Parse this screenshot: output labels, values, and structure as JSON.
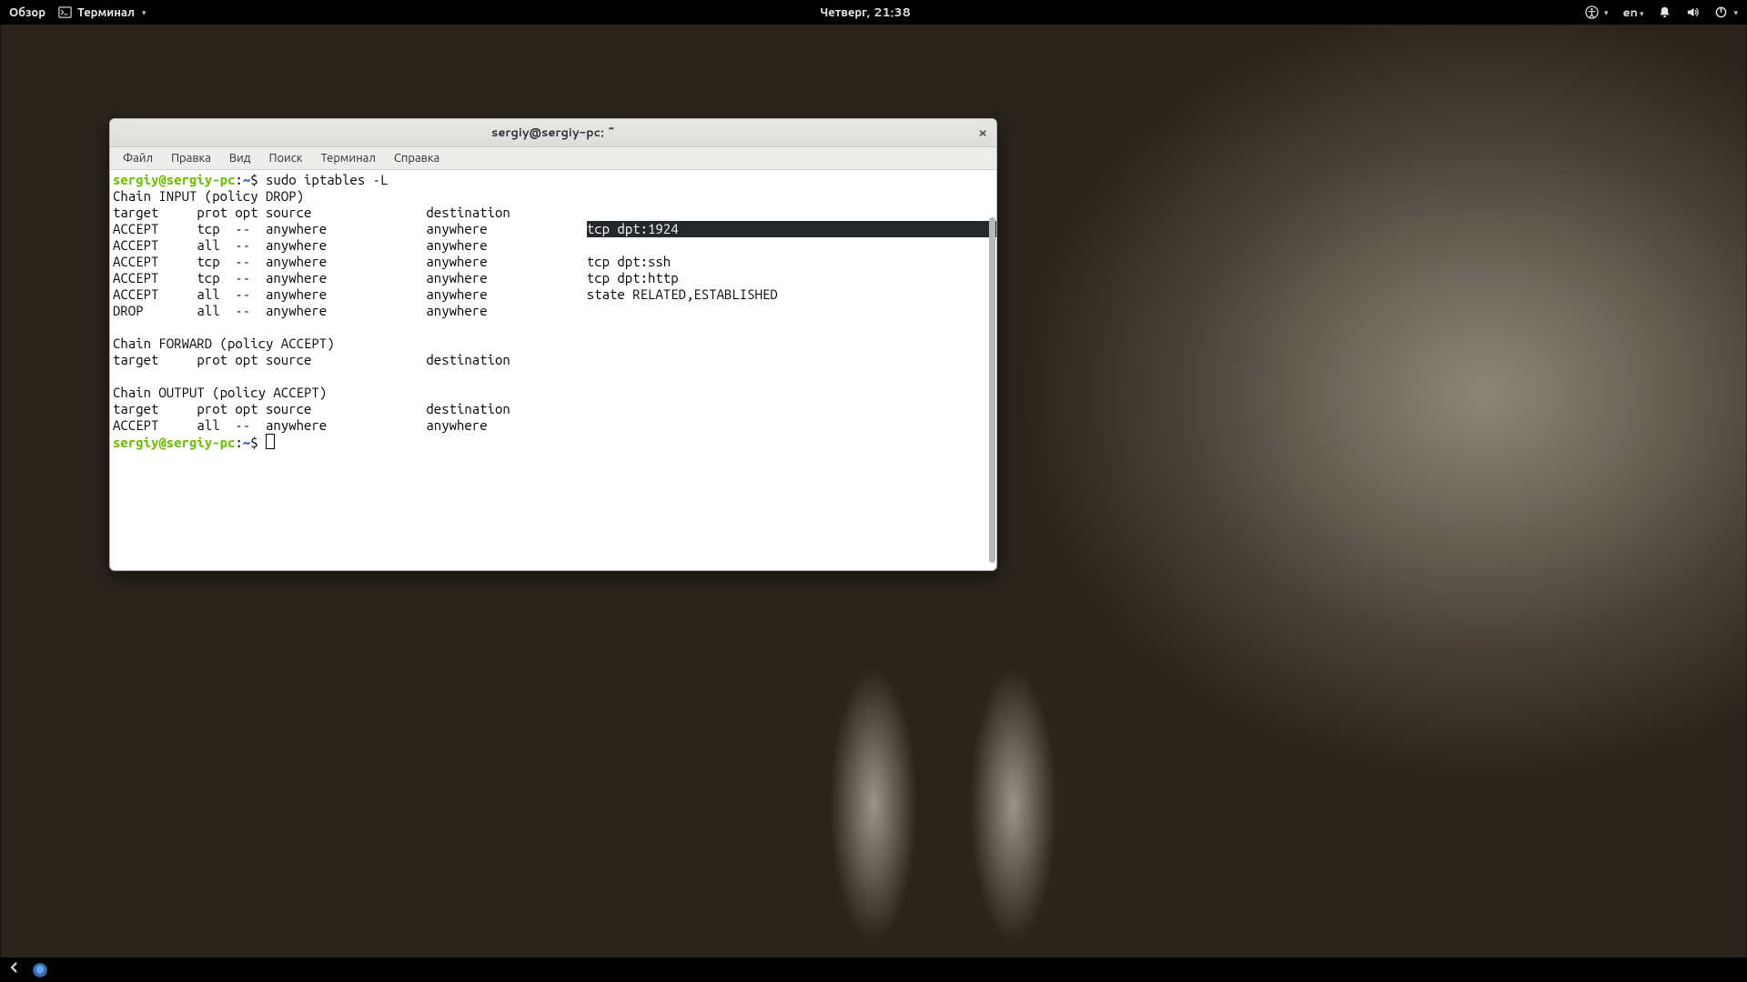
{
  "panel": {
    "activities": "Обзор",
    "app_menu": "Терминал",
    "clock": "Четверг, 21:38",
    "lang": "en"
  },
  "window": {
    "title": "sergiy@sergiy-pc: ~"
  },
  "menubar": {
    "file": "Файл",
    "edit": "Правка",
    "view": "Вид",
    "search": "Поиск",
    "terminal": "Терминал",
    "help": "Справка"
  },
  "terminal": {
    "prompt_user_host": "sergiy@sergiy-pc",
    "prompt_sep": ":",
    "prompt_path": "~",
    "prompt_dollar": "$",
    "command": "sudo iptables -L",
    "selected_extra": "tcp dpt:1924",
    "lines": {
      "chain_input": "Chain INPUT (policy DROP)",
      "hdr": "target     prot opt source               destination",
      "r1a": "ACCEPT     tcp  --  anywhere             anywhere             ",
      "r2": "ACCEPT     all  --  anywhere             anywhere",
      "r3": "ACCEPT     tcp  --  anywhere             anywhere             tcp dpt:ssh",
      "r4": "ACCEPT     tcp  --  anywhere             anywhere             tcp dpt:http",
      "r5": "ACCEPT     all  --  anywhere             anywhere             state RELATED,ESTABLISHED",
      "r6": "DROP       all  --  anywhere             anywhere",
      "blank": "",
      "chain_forward": "Chain FORWARD (policy ACCEPT)",
      "chain_output": "Chain OUTPUT (policy ACCEPT)",
      "out_r1": "ACCEPT     all  --  anywhere             anywhere"
    }
  }
}
